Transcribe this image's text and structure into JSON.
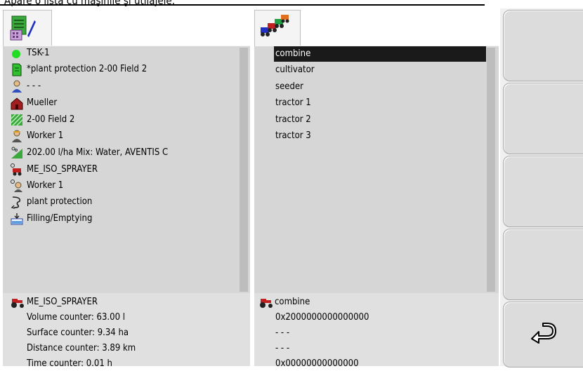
{
  "caption": "Apare o listă cu maşinile şi utilajele:",
  "tabs": {
    "left_icon": "task-data-icon",
    "right_icon": "machines-icon"
  },
  "task_items": [
    {
      "icon": "green-dot-icon",
      "label": "TSK-1"
    },
    {
      "icon": "document-icon",
      "label": "*plant protection 2-00 Field 2"
    },
    {
      "icon": "customer-icon",
      "label": "- - -"
    },
    {
      "icon": "farm-icon",
      "label": "Mueller"
    },
    {
      "icon": "field-icon",
      "label": "2-00 Field 2"
    },
    {
      "icon": "worker-icon",
      "label": "Worker 1"
    },
    {
      "icon": "product-icon",
      "label": "202.00 l/ha Mix: Water, AVENTIS C"
    },
    {
      "icon": "machine-icon",
      "label": "ME_ISO_SPRAYER"
    },
    {
      "icon": "worker-assign-icon",
      "label": "Worker 1"
    },
    {
      "icon": "operation-icon",
      "label": "plant protection"
    },
    {
      "icon": "filling-icon",
      "label": "Filling/Emptying"
    }
  ],
  "machine_list": {
    "selected": "combine",
    "items": [
      "combine",
      "cultivator",
      "seeder",
      "tractor 1",
      "tractor 2",
      "tractor 3"
    ]
  },
  "left_info": {
    "title": "ME_ISO_SPRAYER",
    "lines": [
      "Volume counter: 63.00 l",
      "Surface counter: 9.34 ha",
      "Distance counter: 3.89 km",
      "Time counter: 0.01 h"
    ]
  },
  "right_info": {
    "title": "combine",
    "lines": [
      "0x2000000000000000",
      "- - -",
      "- - -",
      "0x00000000000000"
    ]
  },
  "softkeys": {
    "back_icon": "return-arrow-icon"
  },
  "colors": {
    "panel": "#d6d6d6",
    "selection": "#1a1a1a",
    "softkey": "#dcdcdc"
  }
}
